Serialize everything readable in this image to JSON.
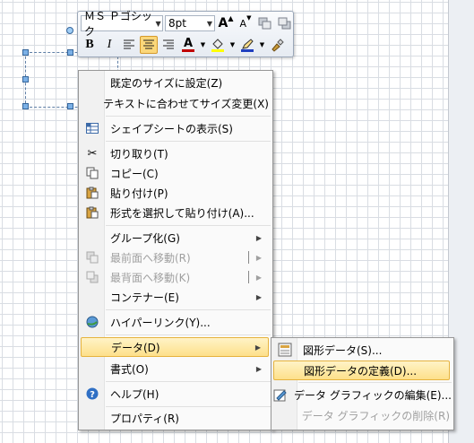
{
  "mini_toolbar": {
    "font_name": "ＭＳ Ｐゴシック",
    "font_size": "8pt",
    "bold": "B",
    "italic": "I",
    "grow_font": "A",
    "shrink_font": "A",
    "font_color_letter": "A",
    "colors": {
      "font": "#c00000",
      "fill": "#ffff00",
      "line": "#1f3fbf",
      "active": "#fbd77a"
    }
  },
  "context_menu": {
    "items": [
      {
        "label": "既定のサイズに設定(Z)"
      },
      {
        "label": "テキストに合わせてサイズ変更(X)"
      },
      {
        "label": "シェイプシートの表示(S)"
      },
      {
        "label": "切り取り(T)"
      },
      {
        "label": "コピー(C)"
      },
      {
        "label": "貼り付け(P)"
      },
      {
        "label": "形式を選択して貼り付け(A)..."
      },
      {
        "label": "グループ化(G)"
      },
      {
        "label": "最前面へ移動(R)"
      },
      {
        "label": "最背面へ移動(K)"
      },
      {
        "label": "コンテナー(E)"
      },
      {
        "label": "ハイパーリンク(Y)..."
      },
      {
        "label": "データ(D)"
      },
      {
        "label": "書式(O)"
      },
      {
        "label": "ヘルプ(H)"
      },
      {
        "label": "プロパティ(R)"
      }
    ]
  },
  "submenu": {
    "items": [
      {
        "label": "図形データ(S)..."
      },
      {
        "label": "図形データの定義(D)..."
      },
      {
        "label": "データ グラフィックの編集(E)..."
      },
      {
        "label": "データ グラフィックの削除(R)"
      }
    ]
  }
}
